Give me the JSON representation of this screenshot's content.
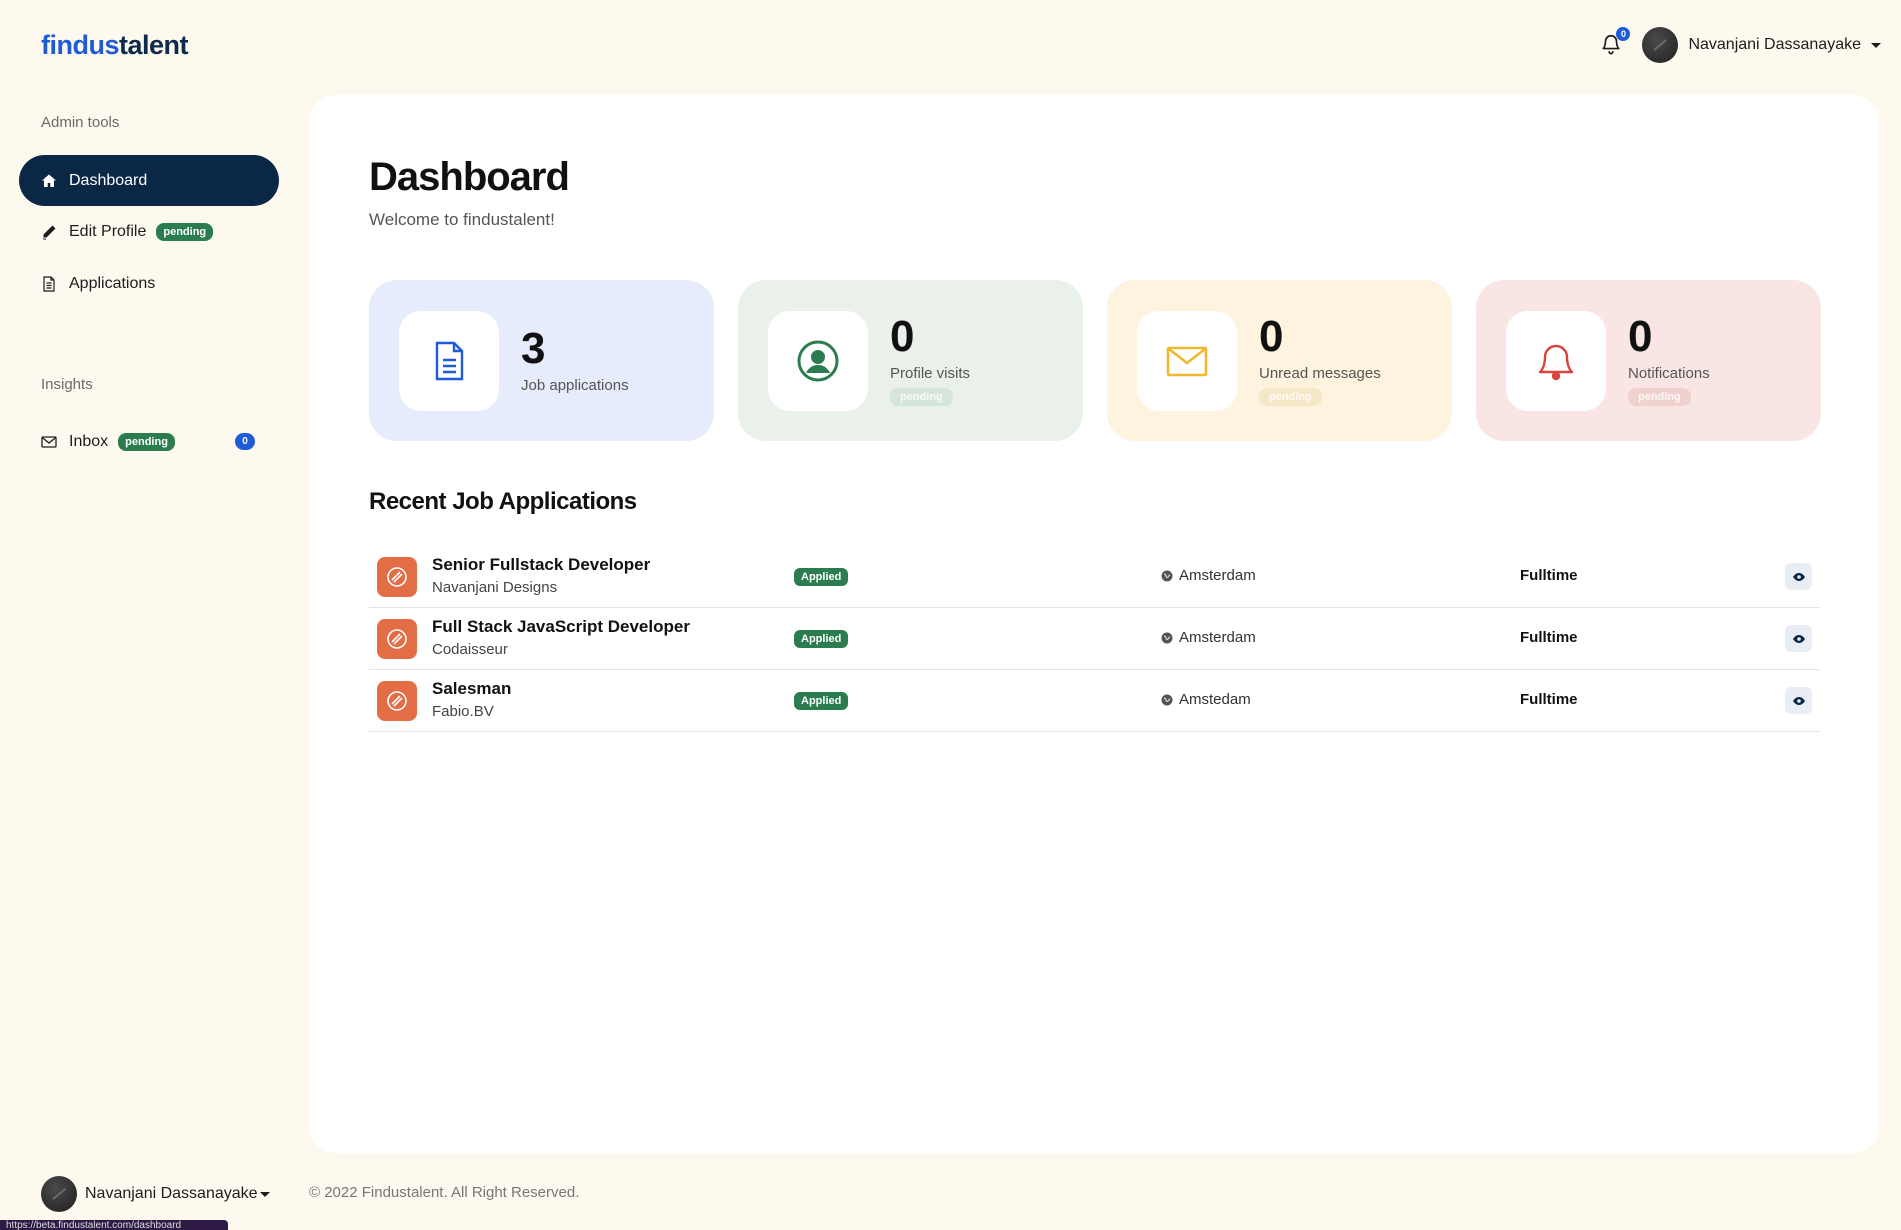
{
  "brand": {
    "part1": "findus",
    "part2": "talent"
  },
  "header": {
    "notification_count": "0",
    "user_name": "Navanjani Dassanayake"
  },
  "sidebar": {
    "admin_heading": "Admin tools",
    "items": [
      {
        "label": "Dashboard",
        "icon": "home-icon",
        "active": true
      },
      {
        "label": "Edit Profile",
        "badge": "pending",
        "icon": "pencil-icon"
      },
      {
        "label": "Applications",
        "icon": "document-icon"
      }
    ],
    "insights_heading": "Insights",
    "inbox": {
      "label": "Inbox",
      "badge": "pending",
      "count": "0",
      "icon": "envelope-icon"
    },
    "footer_user": "Navanjani Dassanayake"
  },
  "status_url": "https://beta.findustalent.com/dashboard",
  "main": {
    "title": "Dashboard",
    "subtitle": "Welcome to findustalent!",
    "stats": [
      {
        "value": "3",
        "label": "Job applications",
        "icon": "document-icon",
        "bg": "#e6ecfb",
        "accent": "#1e5bd6"
      },
      {
        "value": "0",
        "label": "Profile visits",
        "badge": "pending",
        "icon": "user-circle-icon",
        "bg": "#e9f1ea",
        "accent": "#2b7d4f"
      },
      {
        "value": "0",
        "label": "Unread messages",
        "badge": "pending",
        "icon": "envelope-icon",
        "bg": "#fdf3de",
        "accent": "#f0b82e"
      },
      {
        "value": "0",
        "label": "Notifications",
        "badge": "pending",
        "icon": "bell-icon",
        "bg": "#f9e6e4",
        "accent": "#d9443c"
      }
    ],
    "recent_heading": "Recent Job Applications",
    "jobs": [
      {
        "title": "Senior Fullstack Developer",
        "company": "Navanjani Designs",
        "status": "Applied",
        "location": "Amsterdam",
        "type": "Fulltime"
      },
      {
        "title": "Full Stack JavaScript Developer",
        "company": "Codaisseur",
        "status": "Applied",
        "location": "Amsterdam",
        "type": "Fulltime"
      },
      {
        "title": "Salesman",
        "company": "Fabio.BV",
        "status": "Applied",
        "location": "Amstedam",
        "type": "Fulltime"
      }
    ]
  },
  "footer": {
    "copyright": "© 2022 Findustalent. All Right Reserved."
  }
}
